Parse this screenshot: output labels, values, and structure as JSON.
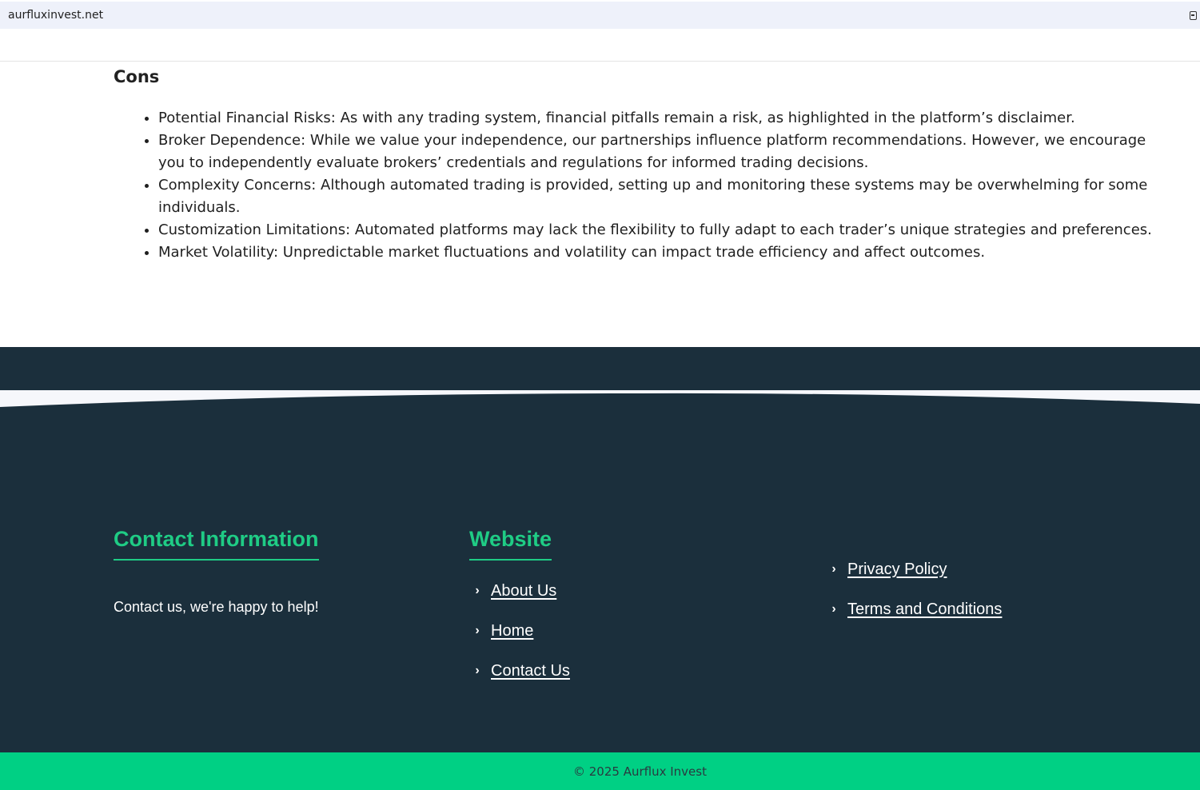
{
  "browser": {
    "url": "aurfluxinvest.net",
    "icon": "copy-icon"
  },
  "cons": {
    "heading": "Cons",
    "items": [
      "Potential Financial Risks: As with any trading system, financial pitfalls remain a risk, as highlighted in the platform’s disclaimer.",
      "Broker Dependence: While we value your independence, our partnerships influence platform recommendations. However, we encourage you to independently evaluate brokers’ credentials and regulations for informed trading decisions.",
      "Complexity Concerns: Although automated trading is provided, setting up and monitoring these systems may be overwhelming for some individuals.",
      "Customization Limitations: Automated platforms may lack the flexibility to fully adapt to each trader’s unique strategies and preferences.",
      "Market Volatility: Unpredictable market fluctuations and volatility can impact trade efficiency and affect outcomes."
    ]
  },
  "footer": {
    "contact": {
      "title": "Contact Information",
      "text": "Contact us, we're happy to help!"
    },
    "website": {
      "title": "Website",
      "links": [
        "About Us",
        "Home",
        "Contact Us"
      ]
    },
    "legal": {
      "links": [
        "Privacy Policy",
        "Terms and Conditions"
      ]
    },
    "copyright": "© 2025 Aurflux Invest"
  },
  "colors": {
    "footer_bg": "#1b2f3c",
    "accent": "#1fcc85",
    "copyright_bg": "#00d084"
  }
}
